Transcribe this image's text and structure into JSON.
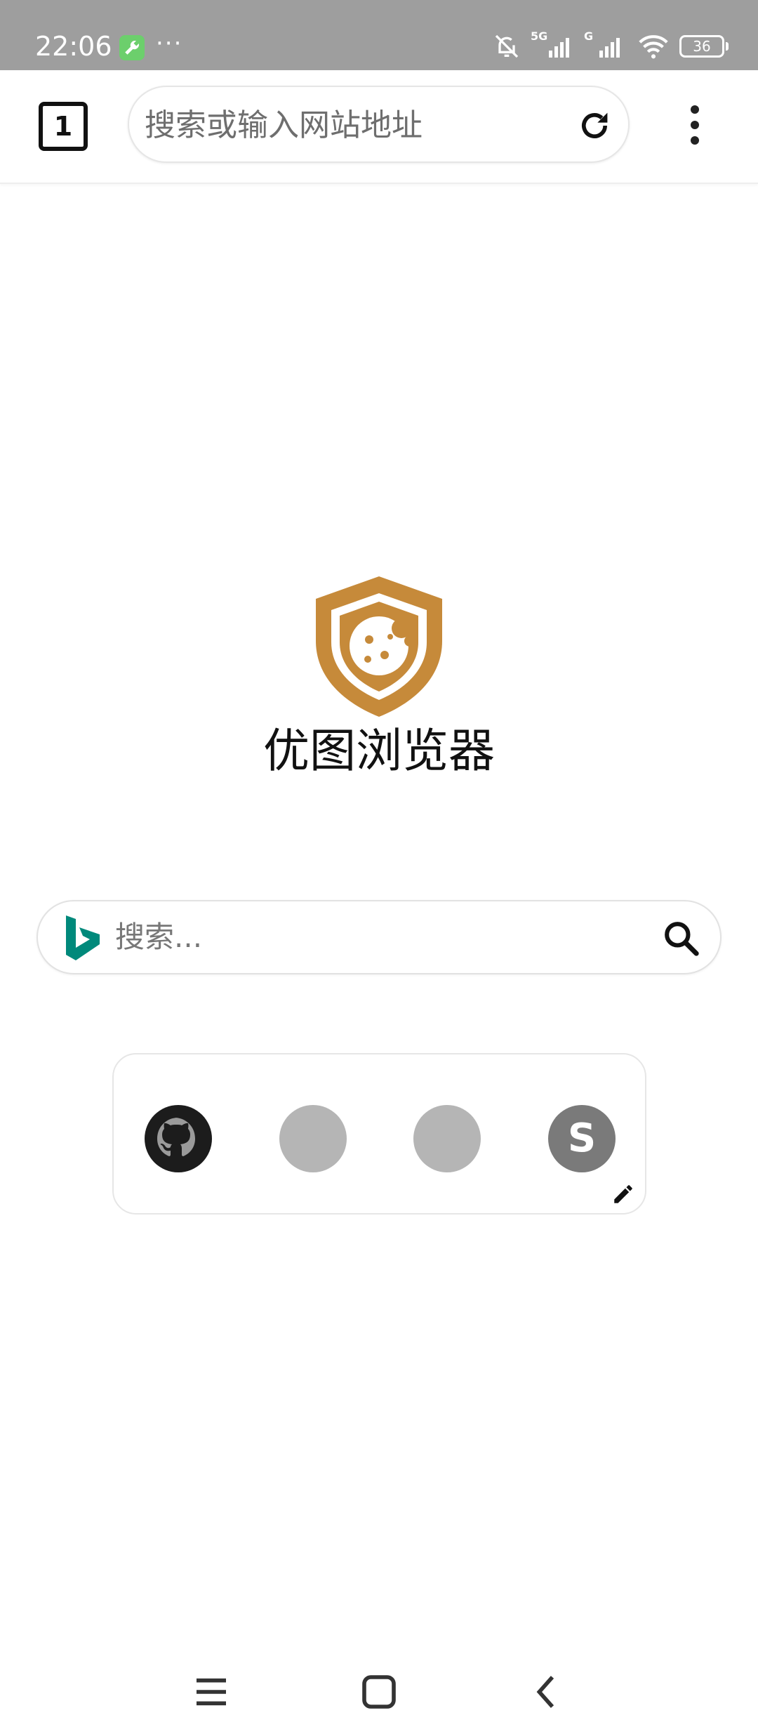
{
  "status_bar": {
    "time": "22:06",
    "more": "···",
    "network_1": "5G",
    "network_2": "G",
    "battery": "36",
    "icons": [
      "wrench-app-icon",
      "bell-off-icon",
      "signal-5g-icon",
      "signal-g-icon",
      "wifi-icon",
      "battery-icon"
    ]
  },
  "toolbar": {
    "tab_count": "1",
    "url_placeholder": "搜索或输入网站地址",
    "icons": [
      "reload-icon",
      "more-vert-icon"
    ]
  },
  "brand": {
    "name": "优图浏览器",
    "logo_color": "#C68A3A"
  },
  "search": {
    "placeholder": "搜索...",
    "engine": "bing",
    "engine_color": "#00897B"
  },
  "speed_dial": {
    "items": [
      {
        "icon": "github-icon"
      },
      {
        "icon": "blank-site-icon"
      },
      {
        "icon": "blank-site-icon"
      },
      {
        "letter": "S"
      }
    ],
    "edit_icon": "pencil-icon"
  },
  "nav_bar": {
    "icons": [
      "menu-icon",
      "home-icon",
      "back-icon"
    ]
  }
}
